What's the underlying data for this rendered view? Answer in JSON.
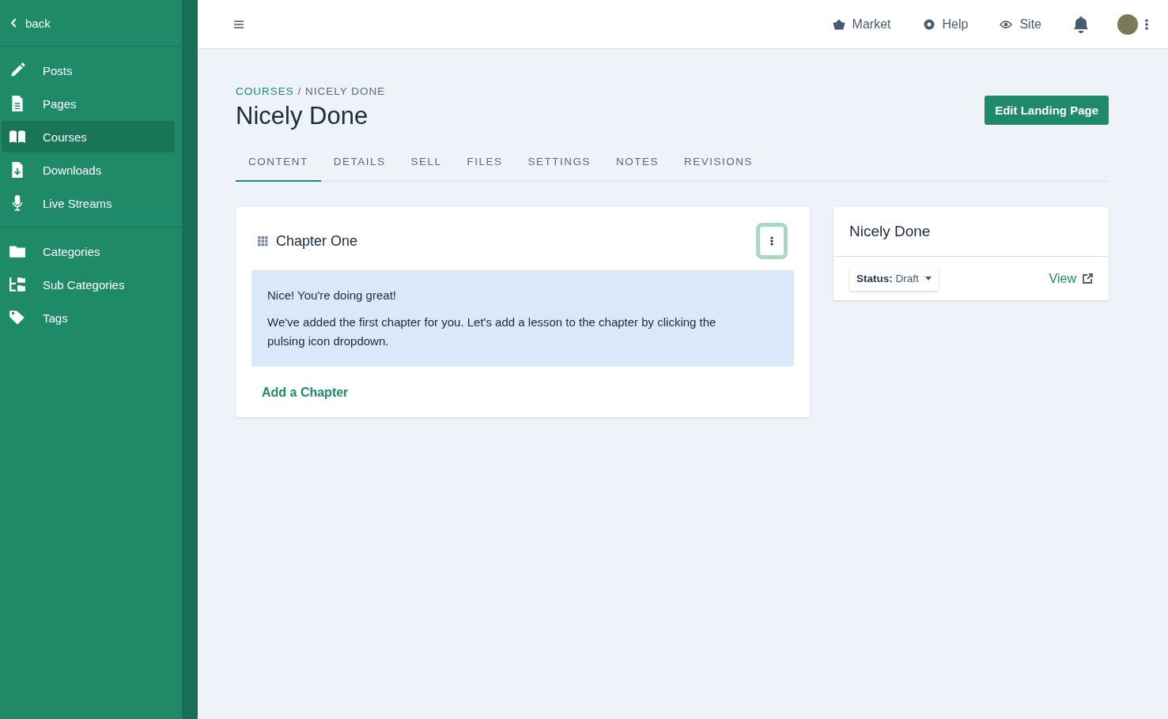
{
  "sidebar": {
    "back": "back",
    "groups": [
      {
        "items": [
          {
            "label": "Posts",
            "selected": false
          },
          {
            "label": "Pages",
            "selected": false
          },
          {
            "label": "Courses",
            "selected": true
          },
          {
            "label": "Downloads",
            "selected": false
          },
          {
            "label": "Live Streams",
            "selected": false
          }
        ]
      },
      {
        "items": [
          {
            "label": "Categories",
            "selected": false
          },
          {
            "label": "Sub Categories",
            "selected": false
          },
          {
            "label": "Tags",
            "selected": false
          }
        ]
      }
    ]
  },
  "topbar": {
    "links": [
      "Market",
      "Help",
      "Site"
    ]
  },
  "breadcrumb": {
    "parent": "COURSES",
    "separator": "/",
    "current": "NICELY DONE"
  },
  "title": "Nicely Done",
  "edit_button": "Edit Landing Page",
  "tabs": [
    {
      "label": "CONTENT",
      "selected": true
    },
    {
      "label": "DETAILS",
      "selected": false
    },
    {
      "label": "SELL",
      "selected": false
    },
    {
      "label": "FILES",
      "selected": false
    },
    {
      "label": "SETTINGS",
      "selected": false
    },
    {
      "label": "NOTES",
      "selected": false
    },
    {
      "label": "REVISIONS",
      "selected": false
    }
  ],
  "chapter": {
    "title": "Chapter One",
    "notice": [
      "Nice! You're doing great!",
      "We've added the first chapter for you. Let's add a lesson to the chapter by clicking the pulsing icon dropdown."
    ],
    "add_link": "Add a Chapter"
  },
  "summary": {
    "title": "Nicely Done",
    "status": "**Status:** Draft",
    "view": "View"
  }
}
